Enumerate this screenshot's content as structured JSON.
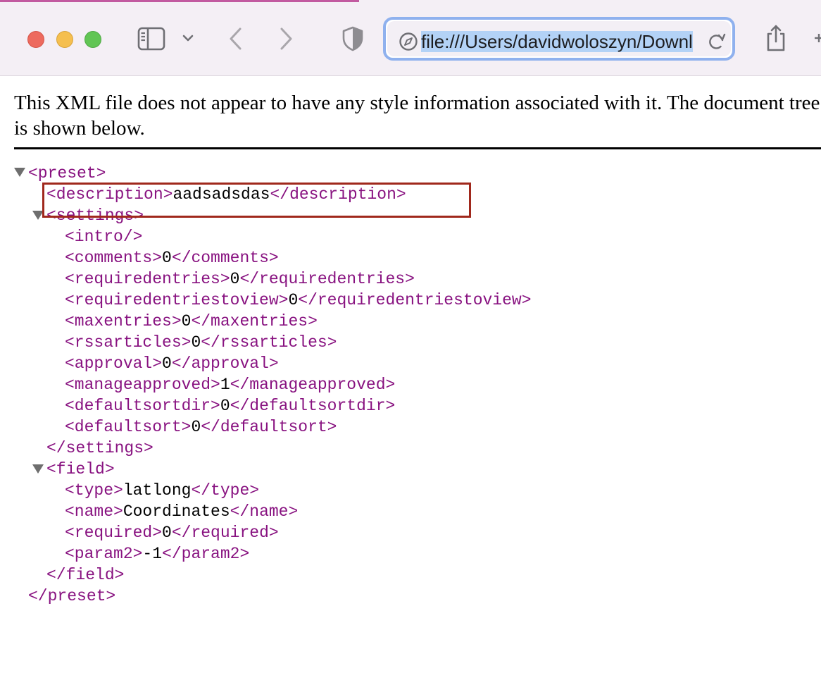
{
  "browser": {
    "url": "file:///Users/davidwoloszyn/Downloads/preset.xml",
    "colors": {
      "toolbar": "#f4eff5",
      "url_focus": "#8fb1ee",
      "selection": "#b3d2f6"
    }
  },
  "document": {
    "notice": "This XML file does not appear to have any style information associated with it. The document tree is shown below.",
    "root_open": "<preset>",
    "root_close": "</preset>",
    "description": {
      "open": "<description>",
      "value": "aadsadsdas",
      "close": "</description>"
    },
    "settings_open": "<settings>",
    "settings_close": "</settings>",
    "intro": "<intro/>",
    "settings": [
      {
        "open": "<comments>",
        "value": "0",
        "close": "</comments>"
      },
      {
        "open": "<requiredentries>",
        "value": "0",
        "close": "</requiredentries>"
      },
      {
        "open": "<requiredentriestoview>",
        "value": "0",
        "close": "</requiredentriestoview>"
      },
      {
        "open": "<maxentries>",
        "value": "0",
        "close": "</maxentries>"
      },
      {
        "open": "<rssarticles>",
        "value": "0",
        "close": "</rssarticles>"
      },
      {
        "open": "<approval>",
        "value": "0",
        "close": "</approval>"
      },
      {
        "open": "<manageapproved>",
        "value": "1",
        "close": "</manageapproved>"
      },
      {
        "open": "<defaultsortdir>",
        "value": "0",
        "close": "</defaultsortdir>"
      },
      {
        "open": "<defaultsort>",
        "value": "0",
        "close": "</defaultsort>"
      }
    ],
    "field_open": "<field>",
    "field_close": "</field>",
    "field": [
      {
        "open": "<type>",
        "value": "latlong",
        "close": "</type>"
      },
      {
        "open": "<name>",
        "value": "Coordinates",
        "close": "</name>"
      },
      {
        "open": "<required>",
        "value": "0",
        "close": "</required>"
      },
      {
        "open": "<param2>",
        "value": "-1",
        "close": "</param2>"
      }
    ],
    "colors": {
      "tag": "#881280",
      "text": "#000000",
      "highlight_box": "#a0281c"
    }
  }
}
